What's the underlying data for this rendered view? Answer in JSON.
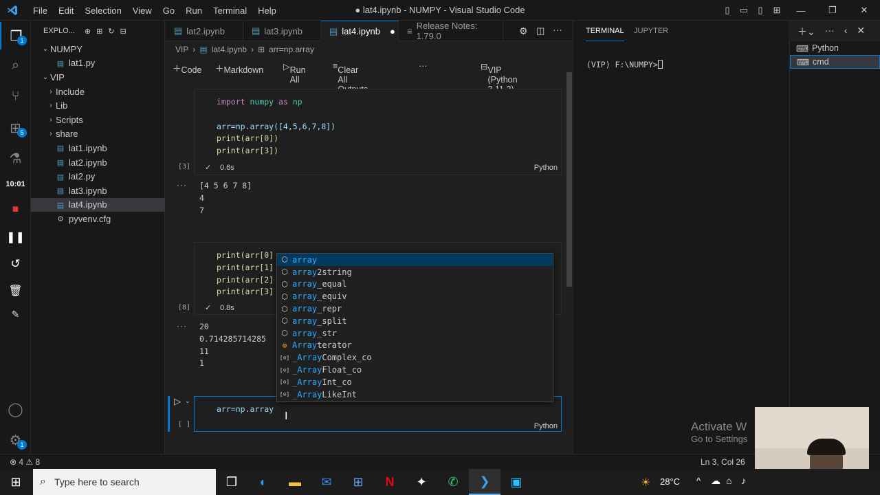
{
  "window": {
    "title": "● lat4.ipynb - NUMPY - Visual Studio Code",
    "menu": [
      "File",
      "Edit",
      "Selection",
      "View",
      "Go",
      "Run",
      "Terminal",
      "Help"
    ]
  },
  "activity": {
    "badges": [
      "1",
      "5"
    ],
    "clock": "10:01"
  },
  "explorer": {
    "header": "EXPLO...",
    "items": [
      {
        "label": "NUMPY",
        "type": "folder-open",
        "indent": 0
      },
      {
        "label": "lat1.py",
        "type": "py",
        "indent": 1
      },
      {
        "label": "VIP",
        "type": "folder-open",
        "indent": 0
      },
      {
        "label": "Include",
        "type": "folder",
        "indent": 1
      },
      {
        "label": "Lib",
        "type": "folder",
        "indent": 1
      },
      {
        "label": "Scripts",
        "type": "folder",
        "indent": 1
      },
      {
        "label": "share",
        "type": "folder",
        "indent": 1
      },
      {
        "label": "lat1.ipynb",
        "type": "ipynb",
        "indent": 1
      },
      {
        "label": "lat2.ipynb",
        "type": "ipynb",
        "indent": 1
      },
      {
        "label": "lat2.py",
        "type": "py",
        "indent": 1
      },
      {
        "label": "lat3.ipynb",
        "type": "ipynb",
        "indent": 1
      },
      {
        "label": "lat4.ipynb",
        "type": "ipynb",
        "indent": 1,
        "selected": true
      },
      {
        "label": "pyvenv.cfg",
        "type": "cfg",
        "indent": 1
      }
    ]
  },
  "tabs": [
    "lat2.ipynb",
    "lat3.ipynb",
    "lat4.ipynb",
    "Release Notes: 1.79.0"
  ],
  "breadcrumb": [
    "VIP",
    "lat4.ipynb",
    "arr=np.array"
  ],
  "toolbar": {
    "code": "Code",
    "markdown": "Markdown",
    "run_all": "Run All",
    "clear": "Clear All Outputs",
    "kernel": "VIP (Python 3.11.3)"
  },
  "cells": [
    {
      "exec": "[3]",
      "time": "0.6s",
      "lang": "Python",
      "output": [
        "[4 5 6 7 8]",
        "4",
        "7"
      ]
    },
    {
      "exec": "[8]",
      "time": "0.8s",
      "lang": "Python",
      "output": [
        "20",
        "0.714285714285",
        "11",
        "1"
      ]
    },
    {
      "exec": "[ ]",
      "lang": "Python",
      "code": "arr=np.array"
    }
  ],
  "code1": {
    "l1a": "import",
    "l1b": "numpy",
    "l1c": "as",
    "l1d": "np",
    "l2": "arr=np.array([4,5,6,7,8])",
    "l3": "print(arr[0])",
    "l4": "print(arr[3])"
  },
  "code2": [
    "print(arr[0]",
    "print(arr[1]",
    "print(arr[2]",
    "print(arr[3]"
  ],
  "suggestions": [
    {
      "match": "array",
      "rest": "",
      "kind": "module"
    },
    {
      "match": "array",
      "rest": "2string",
      "kind": "module"
    },
    {
      "match": "array",
      "rest": "_equal",
      "kind": "module"
    },
    {
      "match": "array",
      "rest": "_equiv",
      "kind": "module"
    },
    {
      "match": "array",
      "rest": "_repr",
      "kind": "module"
    },
    {
      "match": "array",
      "rest": "_split",
      "kind": "module"
    },
    {
      "match": "array",
      "rest": "_str",
      "kind": "module"
    },
    {
      "match": "Array",
      "rest": "terator",
      "kind": "class"
    },
    {
      "match": "_Array",
      "rest": "Complex_co",
      "kind": "variable"
    },
    {
      "match": "_Array",
      "rest": "Float_co",
      "kind": "variable"
    },
    {
      "match": "_Array",
      "rest": "Int_co",
      "kind": "variable"
    },
    {
      "match": "_Array",
      "rest": "LikeInt",
      "kind": "variable"
    }
  ],
  "panel": {
    "tabs": [
      "TERMINAL",
      "JUPYTER"
    ],
    "prompt": "(VIP) F:\\NUMPY>",
    "terminals": [
      "Python",
      "cmd"
    ]
  },
  "status": {
    "problems": "⊗ 4 ⚠ 8",
    "cursor": "Ln 3, Col 26"
  },
  "watermark": {
    "line1": "Activate W",
    "line2": "Go to Settings"
  },
  "taskbar": {
    "search": "Type here to search",
    "weather": "28°C"
  }
}
